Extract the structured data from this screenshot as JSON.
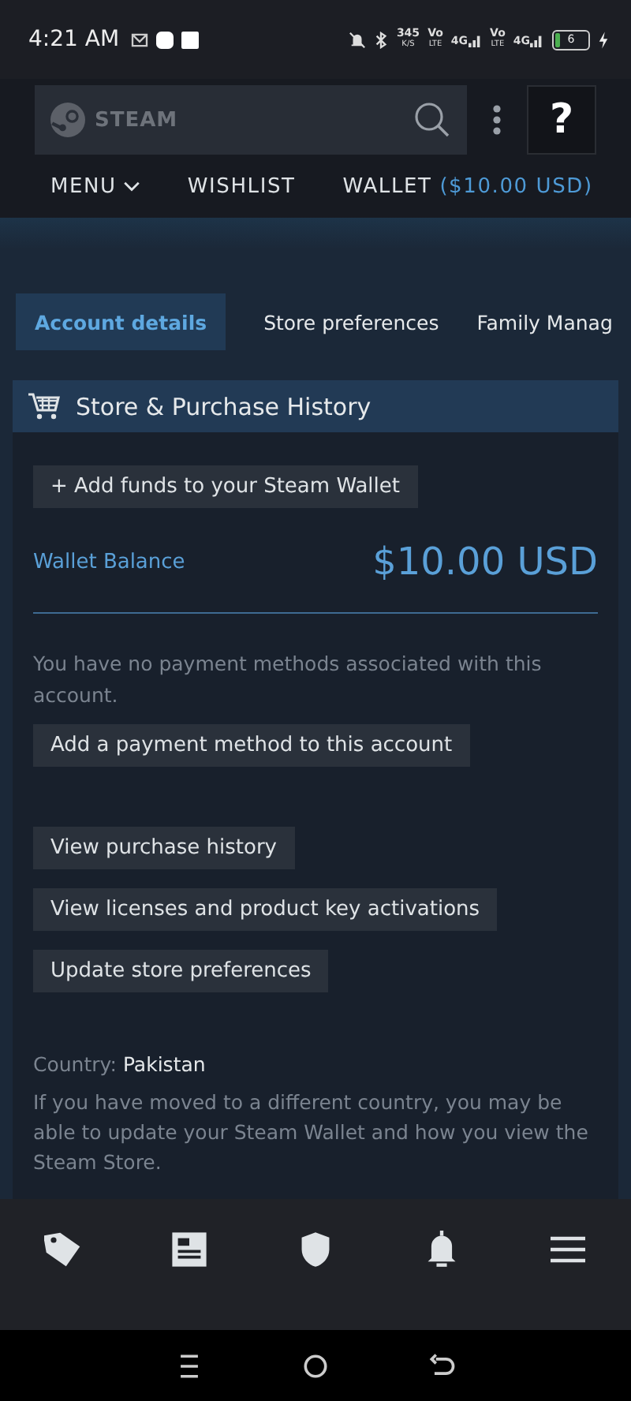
{
  "status_bar": {
    "time": "4:21 AM",
    "speed": "345",
    "speed_unit": "K/S",
    "sims": [
      {
        "volte": "Vo",
        "lte": "LTE",
        "net": "4G"
      },
      {
        "volte": "Vo",
        "lte": "LTE",
        "net": "4G"
      }
    ],
    "battery": "6"
  },
  "header": {
    "logo": "STEAM",
    "help": "?"
  },
  "nav": [
    {
      "label": "MENU",
      "kind": "dropdown"
    },
    {
      "label": "WISHLIST",
      "kind": "link"
    },
    {
      "label": "WALLET",
      "kind": "wallet",
      "amount": "($10.00 USD)"
    }
  ],
  "tabs": [
    {
      "label": "Account details",
      "selected": true
    },
    {
      "label": "Store preferences",
      "selected": false
    },
    {
      "label": "Family Manag",
      "selected": false
    }
  ],
  "section": {
    "title": "Store & Purchase History",
    "add_funds": "+ Add funds to your Steam Wallet",
    "wallet_label": "Wallet Balance",
    "wallet_amount": "$10.00 USD",
    "no_payment": "You have no payment methods associated with this account.",
    "add_payment": "Add a payment method to this account",
    "actions": [
      "View purchase history",
      "View licenses and product key activations",
      "Update store preferences"
    ],
    "country_label": "Country:",
    "country": "Pakistan",
    "country_note": "If you have moved to a different country, you may be able to update your Steam Wallet and how you view the Steam Store."
  },
  "bottom_nav": [
    {
      "kind": "tag"
    },
    {
      "kind": "news"
    },
    {
      "kind": "shield"
    },
    {
      "kind": "bell"
    },
    {
      "kind": "menu"
    }
  ],
  "system_nav": [
    {
      "kind": "recents"
    },
    {
      "kind": "home"
    },
    {
      "kind": "back"
    }
  ]
}
